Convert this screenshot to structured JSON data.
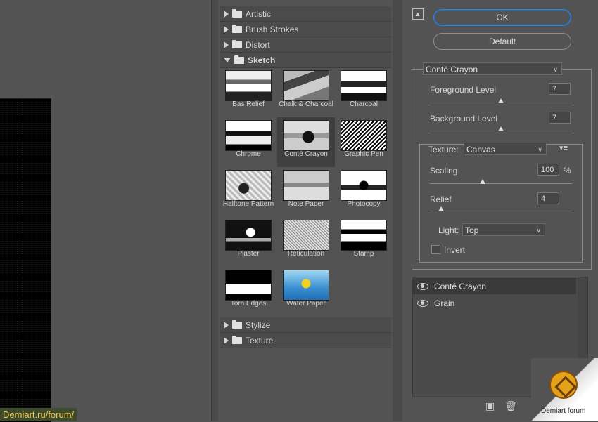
{
  "colors": {
    "background": "#535353",
    "ok_border": "#2c83d8",
    "panel": "#4b4b4b"
  },
  "gallery": {
    "folders_top": [
      {
        "label": "Artistic",
        "open": false
      },
      {
        "label": "Brush Strokes",
        "open": false
      },
      {
        "label": "Distort",
        "open": false
      },
      {
        "label": "Sketch",
        "open": true
      }
    ],
    "thumbnails": [
      {
        "label": "Bas Relief",
        "image": "bas-relief-thumbnail"
      },
      {
        "label": "Chalk & Charcoal",
        "image": "chalk-charcoal-thumbnail"
      },
      {
        "label": "Charcoal",
        "image": "charcoal-thumbnail"
      },
      {
        "label": "Chrome",
        "image": "chrome-thumbnail"
      },
      {
        "label": "Conté Crayon",
        "image": "conte-crayon-thumbnail",
        "selected": true
      },
      {
        "label": "Graphic Pen",
        "image": "graphic-pen-thumbnail"
      },
      {
        "label": "Halftone Pattern",
        "image": "halftone-pattern-thumbnail"
      },
      {
        "label": "Note Paper",
        "image": "note-paper-thumbnail"
      },
      {
        "label": "Photocopy",
        "image": "photocopy-thumbnail"
      },
      {
        "label": "Plaster",
        "image": "plaster-thumbnail"
      },
      {
        "label": "Reticulation",
        "image": "reticulation-thumbnail"
      },
      {
        "label": "Stamp",
        "image": "stamp-thumbnail"
      },
      {
        "label": "Torn Edges",
        "image": "torn-edges-thumbnail"
      },
      {
        "label": "Water Paper",
        "image": "water-paper-thumbnail"
      }
    ],
    "folders_bottom": [
      {
        "label": "Stylize",
        "open": false
      },
      {
        "label": "Texture",
        "open": false
      }
    ]
  },
  "buttons": {
    "ok": "OK",
    "default": "Default",
    "collapse_icon": "collapse-icon"
  },
  "settings": {
    "filter_select": "Conté Crayon",
    "foreground_label": "Foreground Level",
    "foreground_value": "7",
    "foreground_fraction": 0.5,
    "background_label": "Background Level",
    "background_value": "7",
    "background_fraction": 0.5,
    "texture_label": "Texture:",
    "texture_value": "Canvas",
    "scaling_label": "Scaling",
    "scaling_value": "100",
    "scaling_unit": "%",
    "scaling_fraction": 0.37,
    "relief_label": "Relief",
    "relief_value": "4",
    "relief_fraction": 0.08,
    "light_label": "Light:",
    "light_value": "Top",
    "invert_label": "Invert",
    "invert_checked": false
  },
  "layers": [
    {
      "label": "Conté Crayon",
      "active": true
    },
    {
      "label": "Grain",
      "active": false
    }
  ],
  "watermark": {
    "url": "Demiart.ru/forum/",
    "brand": "Demiart forum"
  }
}
